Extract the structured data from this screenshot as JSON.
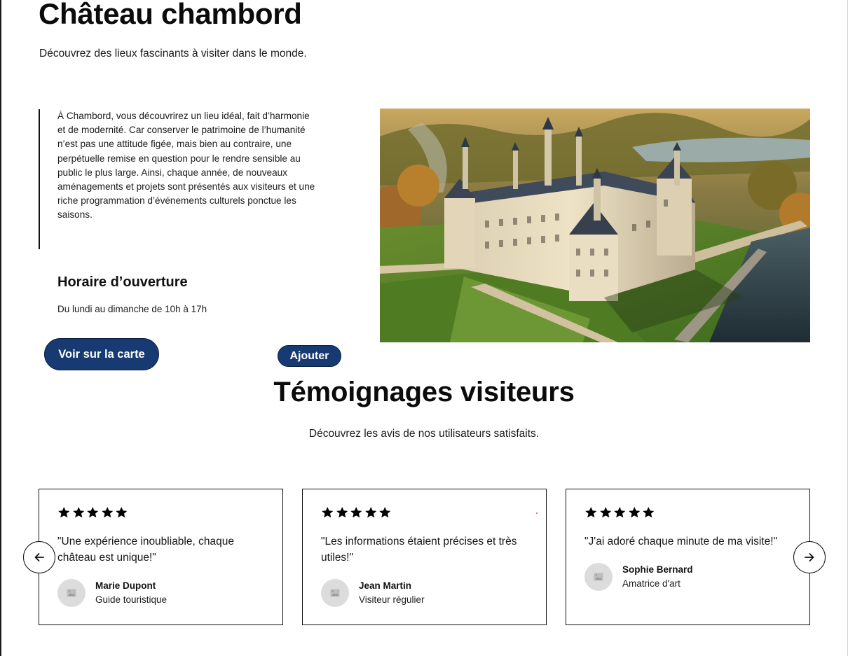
{
  "header": {
    "title": "Château chambord",
    "subtitle": "Découvrez des lieux fascinants à visiter dans le monde."
  },
  "main": {
    "description": "À Chambord, vous découvrirez un lieu idéal, fait d’harmonie et de modernité. Car conserver le patrimoine de l’humanité n’est pas une attitude figée, mais bien au contraire, une perpétuelle remise en question pour le rendre sensible au public le plus large. Ainsi, chaque année, de nouveaux aménagements et projets sont présentés aux visiteurs et une riche programmation d’événements culturels ponctue les saisons.",
    "hours_title": "Horaire d’ouverture",
    "hours_text": "Du lundi au dimanche de 10h à 17h",
    "map_button_label": "Voir sur la carte",
    "add_button_label": "Ajouter",
    "image_icon": "chateau-aerial-photo"
  },
  "testimonials": {
    "title": "Témoignages visiteurs",
    "subtitle": "Découvrez les avis de nos utilisateurs satisfaits.",
    "prev_icon": "arrow-left-icon",
    "next_icon": "arrow-right-icon",
    "cards": [
      {
        "rating": 5,
        "quote": "\"Une expérience inoubliable, chaque château est unique!\"",
        "name": "Marie Dupont",
        "role": "Guide touristique"
      },
      {
        "rating": 5,
        "quote": "\"Les informations étaient précises et très utiles!\"",
        "name": "Jean Martin",
        "role": "Visiteur régulier"
      },
      {
        "rating": 5,
        "quote": "\"J'ai adoré chaque minute de ma visite!\"",
        "name": "Sophie Bernard",
        "role": "Amatrice d'art"
      }
    ]
  },
  "colors": {
    "primary_button": "#173a73",
    "text": "#111111",
    "avatar_bg": "#dcdcdc"
  }
}
